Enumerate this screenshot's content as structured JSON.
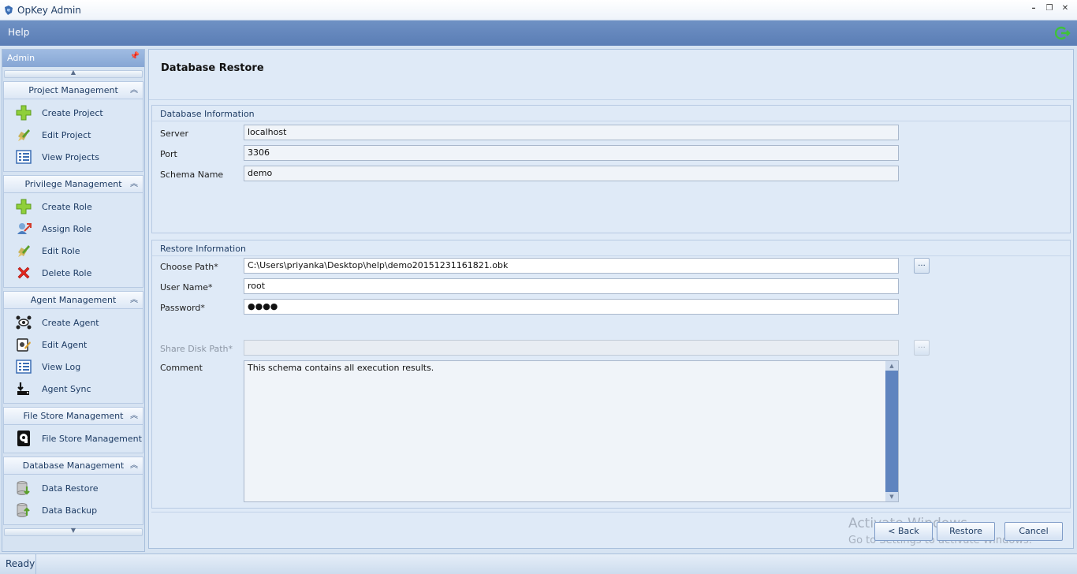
{
  "window": {
    "title": "OpKey Admin"
  },
  "menu": {
    "help": "Help"
  },
  "sidebar": {
    "title": "Admin",
    "groups": [
      {
        "title": "Project Management",
        "items": [
          {
            "label": "Create Project",
            "icon": "plus-icon"
          },
          {
            "label": "Edit Project",
            "icon": "edit-icon"
          },
          {
            "label": "View Projects",
            "icon": "list-icon"
          }
        ]
      },
      {
        "title": "Privilege Management",
        "items": [
          {
            "label": "Create Role",
            "icon": "plus-icon"
          },
          {
            "label": "Assign Role",
            "icon": "assign-role-icon"
          },
          {
            "label": "Edit Role",
            "icon": "edit-icon"
          },
          {
            "label": "Delete Role",
            "icon": "delete-icon"
          }
        ]
      },
      {
        "title": "Agent Management",
        "items": [
          {
            "label": "Create Agent",
            "icon": "agent-icon"
          },
          {
            "label": "Edit Agent",
            "icon": "edit-agent-icon"
          },
          {
            "label": "View Log",
            "icon": "list-icon"
          },
          {
            "label": "Agent Sync",
            "icon": "sync-icon"
          }
        ]
      },
      {
        "title": "File Store Management",
        "items": [
          {
            "label": "File Store Management",
            "icon": "file-store-icon"
          }
        ]
      },
      {
        "title": "Database Management",
        "items": [
          {
            "label": "Data Restore",
            "icon": "database-restore-icon"
          },
          {
            "label": "Data Backup",
            "icon": "database-backup-icon"
          }
        ]
      }
    ]
  },
  "page": {
    "title": "Database Restore"
  },
  "db_info": {
    "title": "Database Information",
    "server_label": "Server",
    "server_value": "localhost",
    "port_label": "Port",
    "port_value": "3306",
    "schema_label": "Schema Name",
    "schema_value": "demo"
  },
  "restore_info": {
    "title": "Restore Information",
    "path_label": "Choose Path*",
    "path_value": "C:\\Users\\priyanka\\Desktop\\help\\demo20151231161821.obk",
    "browse_label": "...",
    "user_label": "User Name*",
    "user_value": "root",
    "password_label": "Password*",
    "password_value": "●●●●",
    "share_label": "Share Disk Path*",
    "share_value": "",
    "comment_label": "Comment",
    "comment_value": "This schema contains all execution results."
  },
  "footer": {
    "back_label": "< Back",
    "restore_label": "Restore",
    "cancel_label": "Cancel",
    "watermark_line1": "Activate Windows",
    "watermark_line2": "Go to Settings to activate Windows."
  },
  "status": {
    "text": "Ready"
  },
  "colors": {
    "menubar": "#5a7db5",
    "sidebar_header": "#86a6d4",
    "scrollbar": "#5f84bf"
  }
}
